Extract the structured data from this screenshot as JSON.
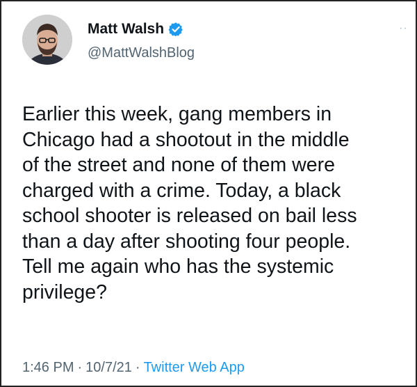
{
  "author": {
    "display_name": "Matt Walsh",
    "handle": "@MattWalshBlog",
    "verified": true
  },
  "tweet": {
    "lines": [
      "Earlier this week, gang members in",
      "Chicago had a shootout in the middle",
      "of the street and none of them were",
      "charged with a crime. Today, a black",
      "school shooter is released on bail less",
      "than a day after shooting four people.",
      "Tell me again who has the systemic",
      "privilege?"
    ]
  },
  "meta": {
    "time": "1:46 PM",
    "separator": "·",
    "date": "10/7/21",
    "source": "Twitter Web App"
  },
  "icons": {
    "verified": "verified-badge-icon",
    "more": "more-options-icon"
  },
  "colors": {
    "verified": "#1d9bf0",
    "link": "#1d9bf0",
    "secondary_text": "#536471",
    "primary_text": "#0f1419"
  }
}
